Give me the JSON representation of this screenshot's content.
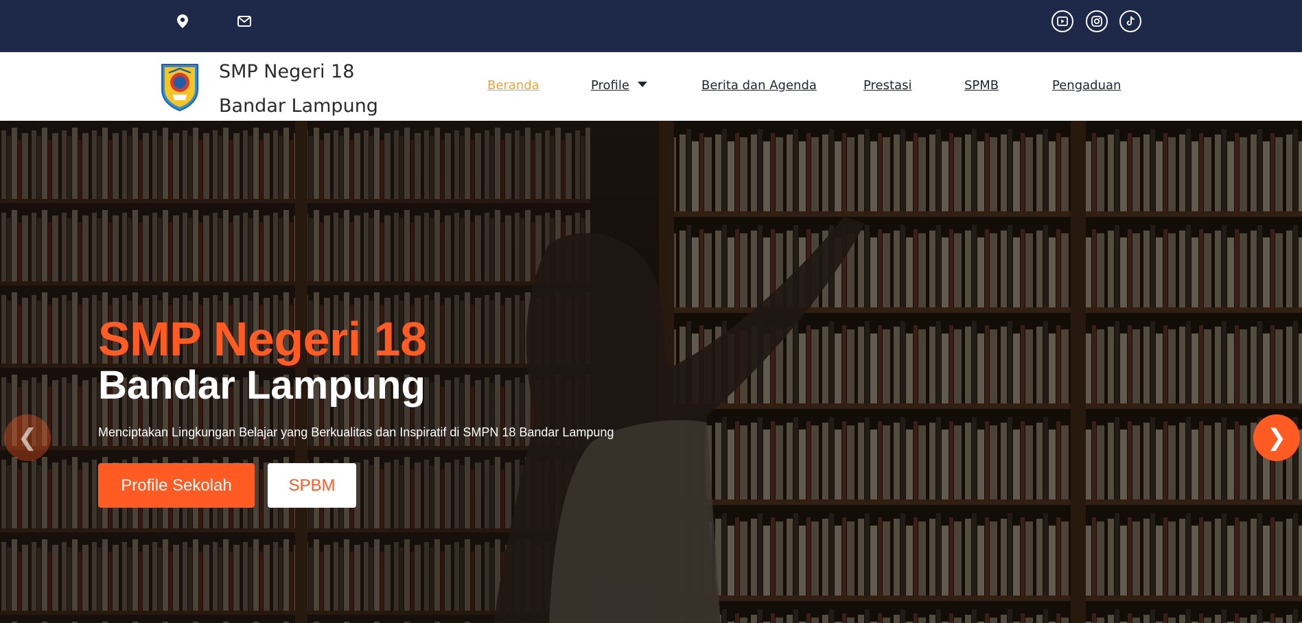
{
  "topbar": {
    "icons": [
      "location-pin-icon",
      "envelope-icon"
    ],
    "social": [
      "youtube-icon",
      "instagram-icon",
      "tiktok-icon"
    ]
  },
  "brand": {
    "line1": "SMP Negeri 18",
    "line2": "Bandar Lampung"
  },
  "nav": {
    "items": [
      {
        "label": "Beranda",
        "active": true
      },
      {
        "label": "Profile",
        "dropdown": true
      },
      {
        "label": "Berita dan Agenda"
      },
      {
        "label": "Prestasi"
      },
      {
        "label": "SPMB"
      },
      {
        "label": "Pengaduan"
      }
    ]
  },
  "hero": {
    "title_line1": "SMP Negeri 18",
    "title_line2": "Bandar Lampung",
    "subtitle": "Menciptakan Lingkungan Belajar yang Berkualitas dan Inspiratif di SMPN 18 Bandar Lampung",
    "primary_button": "Profile Sekolah",
    "secondary_button": "SPBM",
    "prev_arrow": "❮",
    "next_arrow": "❯"
  },
  "colors": {
    "topbar_bg": "#1e2949",
    "accent": "#ff5b22",
    "active_nav": "#f3a33a"
  }
}
